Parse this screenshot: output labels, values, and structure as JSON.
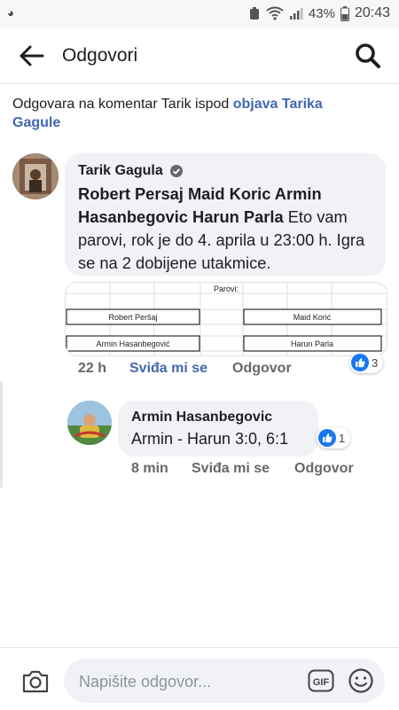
{
  "status_bar": {
    "left_icon": "notification-icon",
    "battery_percent": "43%",
    "time": "20:43"
  },
  "header": {
    "title": "Odgovori"
  },
  "context": {
    "prefix": "Odgovara na komentar Tarik ispod ",
    "link": "objava Tarika Gagule"
  },
  "comment": {
    "author": "Tarik Gagula",
    "tags": "Robert Persaj Maid Koric Armin Hasanbegovic Harun Parla",
    "text": " Eto vam parovi, rok je do 4. aprila u 23:00 h. Igra se na 2 dobijene utakmice.",
    "attachment": {
      "title": "Parovi:",
      "cells": [
        "Robert Peršaj",
        "Maid Korić",
        "Armin Hasanbegović",
        "Harun Parla"
      ]
    },
    "time": "22 h",
    "like_label": "Sviđa mi se",
    "reply_label": "Odgovor",
    "reaction_count": "3"
  },
  "reply": {
    "author": "Armin Hasanbegovic",
    "text": "Armin - Harun 3:0, 6:1",
    "time": "8 min",
    "like_label": "Sviđa mi se",
    "reply_label": "Odgovor",
    "reaction_count": "1"
  },
  "composer": {
    "placeholder": "Napišite odgovor..."
  },
  "colors": {
    "link": "#4267b2",
    "bubble": "#f0f2f5",
    "meta": "#65676b"
  }
}
